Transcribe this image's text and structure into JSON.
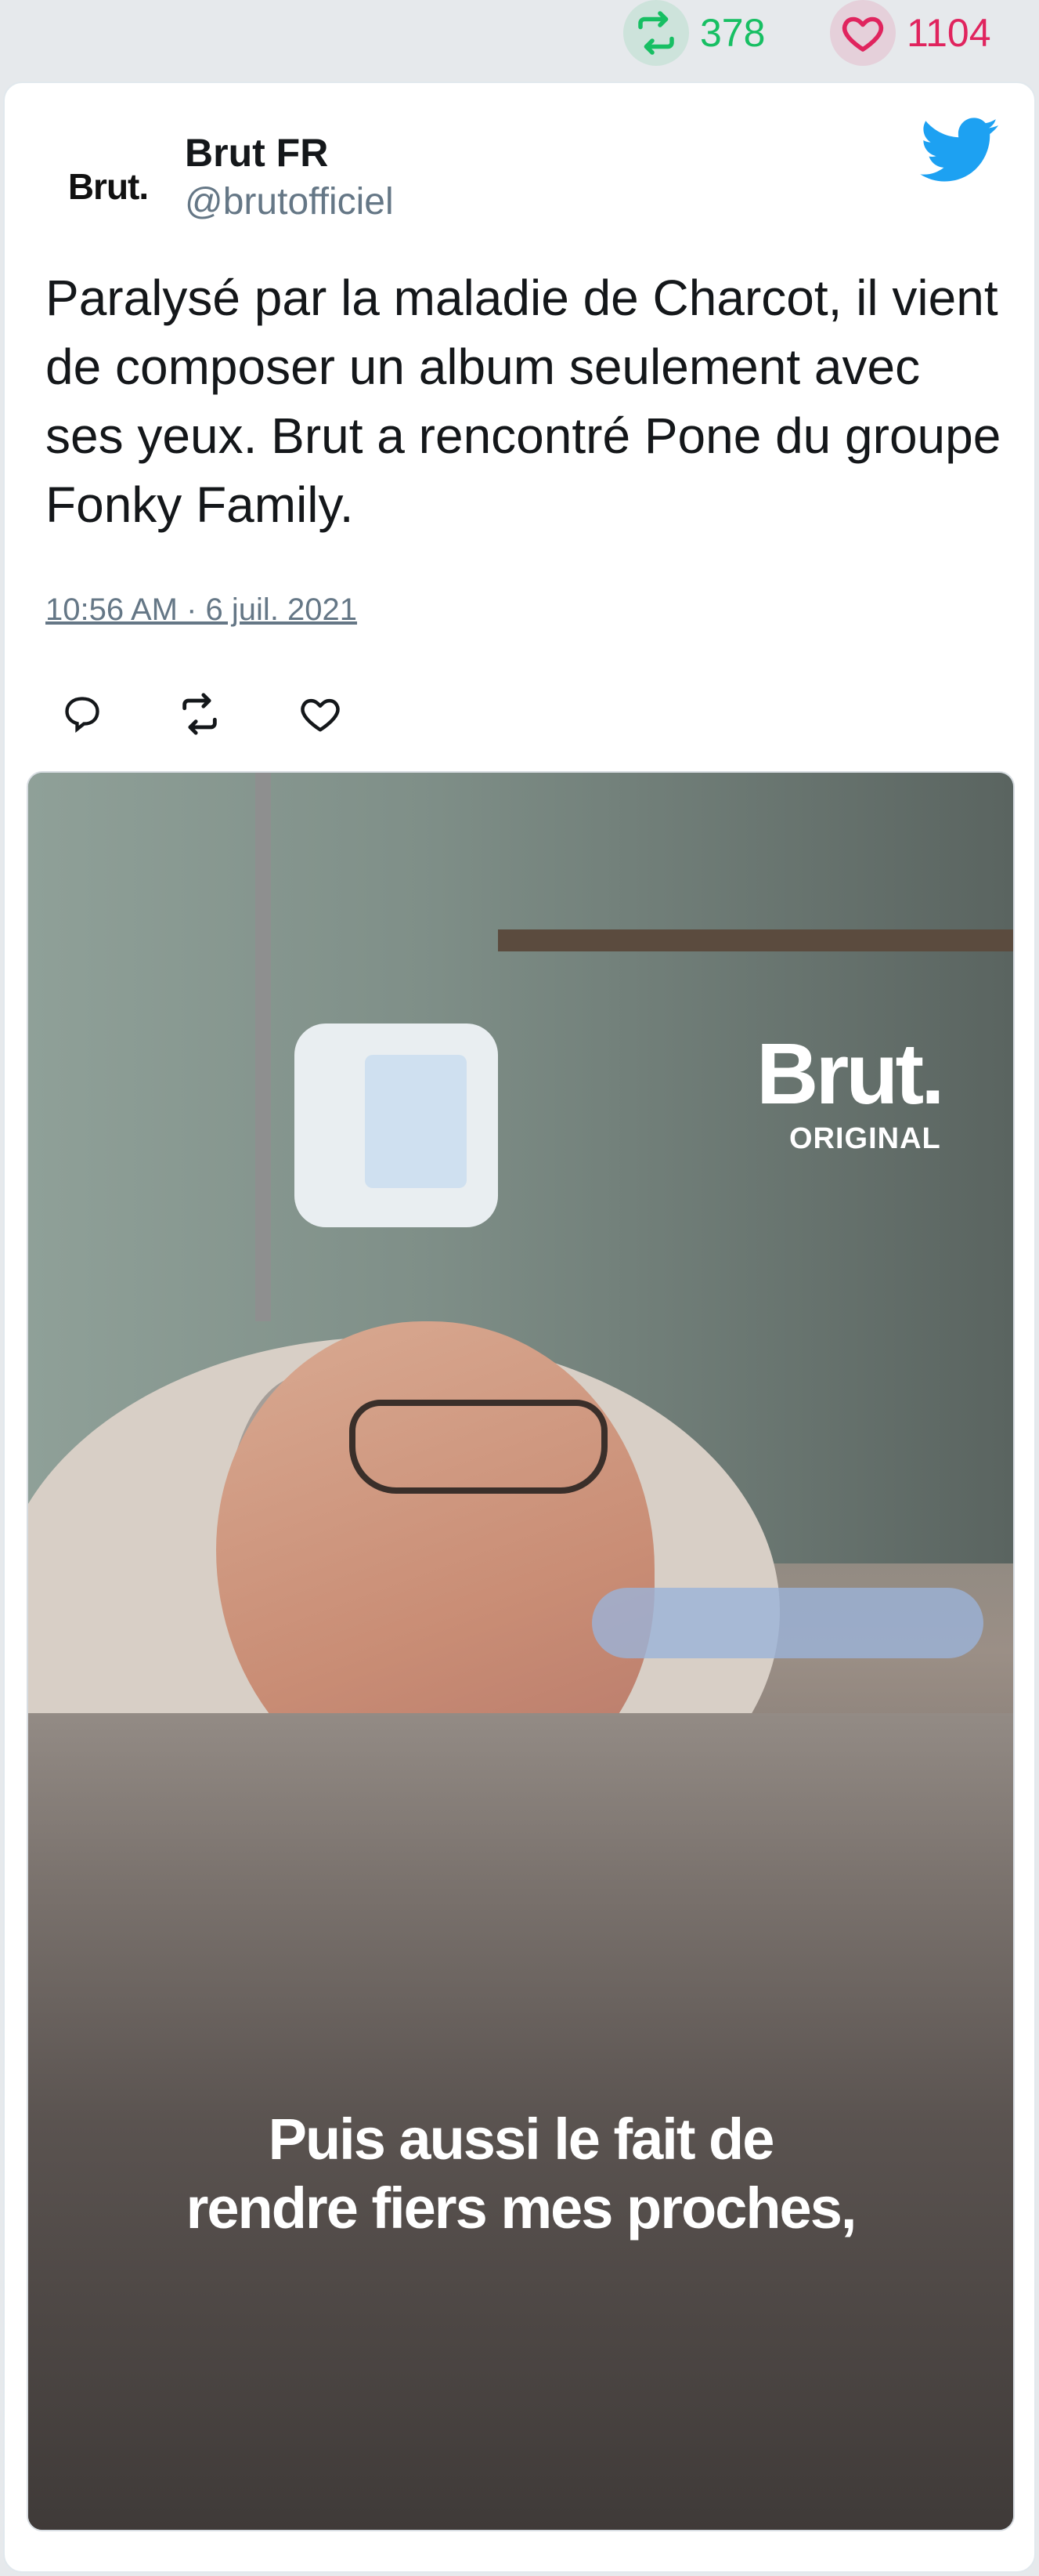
{
  "stats": {
    "retweets": "378",
    "likes": "1104"
  },
  "author": {
    "avatar_text": "Brut.",
    "name": "Brut FR",
    "handle": "@brutofficiel"
  },
  "tweet": {
    "text": "Paralysé par la maladie de Charcot, il vient de composer un album seulement avec ses yeux. Brut a rencontré Pone du groupe Fonky Family.",
    "timestamp": "10:56 AM · 6 juil. 2021"
  },
  "media": {
    "brand": "Brut.",
    "brand_sub": "ORIGINAL",
    "caption_line1": "Puis aussi le fait de",
    "caption_line2": "rendre fiers mes proches,"
  },
  "colors": {
    "retweet": "#17bf63",
    "like": "#e0245e",
    "twitter_blue": "#1da1f2",
    "secondary_text": "#657786"
  },
  "icons": {
    "retweet": "retweet-icon",
    "like": "heart-icon",
    "reply": "reply-icon",
    "logo": "twitter-bird-icon"
  }
}
